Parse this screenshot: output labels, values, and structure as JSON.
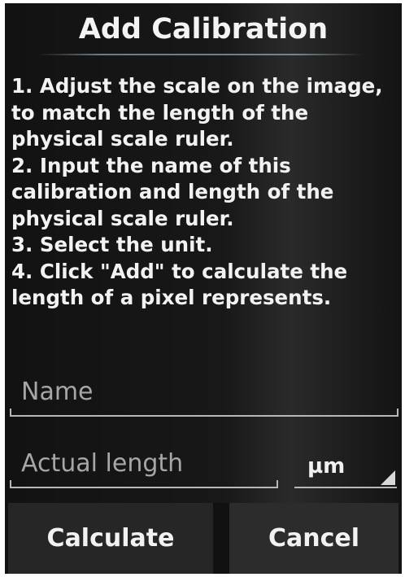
{
  "dialog": {
    "title": "Add Calibration",
    "instructions": "1. Adjust the scale on the image,\nto match the length of the\nphysical scale ruler.\n 2. Input the name of this\ncalibration and length of the\nphysical scale ruler.\n 3. Select the unit.\n 4. Click \"Add\" to calculate the\nlength of a pixel represents."
  },
  "form": {
    "name_placeholder": "Name",
    "name_value": "",
    "length_placeholder": "Actual length",
    "length_value": "",
    "unit_selected": "µm"
  },
  "buttons": {
    "calculate_label": "Calculate",
    "cancel_label": "Cancel"
  },
  "colors": {
    "background": "#181818",
    "text": "#f2f2f2",
    "hint": "#a6a6a6",
    "button": "#262626"
  }
}
